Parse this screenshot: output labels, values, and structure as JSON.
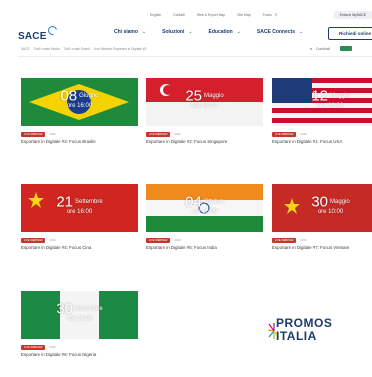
{
  "utility": {
    "links": [
      "English",
      "Contatti",
      "Web & Export Map",
      "Site Map",
      "Focus"
    ],
    "access": "Entra in MySACE"
  },
  "header": {
    "brand": "SACE",
    "nav": [
      {
        "label": "Chi siamo"
      },
      {
        "label": "Soluzioni"
      },
      {
        "label": "Education"
      },
      {
        "label": "SACE Connects"
      }
    ],
    "cta": "Richiedi online"
  },
  "breadcrumb": [
    "SACE",
    "Tutti i nostri Media",
    "Tutti i nostri Eventi",
    "Live Webinar Esportare in Digitale #3"
  ],
  "share": {
    "label": "Condividi"
  },
  "cards": [
    {
      "day": "08",
      "month": "Giugno",
      "hour": "ore 16:00",
      "tag": "LIVE WEBINAR",
      "year": "2020",
      "title": "Esportare in Digitale #3: Focus Brasile",
      "flag": "brazil"
    },
    {
      "day": "25",
      "month": "Maggio",
      "hour": "ore 16:00",
      "tag": "LIVE WEBINAR",
      "year": "2020",
      "title": "Esportare in Digitale #2: Focus Singapore",
      "flag": "singapore"
    },
    {
      "day": "12",
      "month": "Maggio",
      "hour": "ore 16:00",
      "tag": "LIVE WEBINAR",
      "year": "2020",
      "title": "Esportare in Digitale #1: Focus USA",
      "flag": "usa"
    },
    {
      "day": "21",
      "month": "Settembre",
      "hour": "ore 16:00",
      "tag": "LIVE WEBINAR",
      "year": "2020",
      "title": "Esportare in Digitale #4: Focus Cina",
      "flag": "china"
    },
    {
      "day": "04",
      "month": "Ottobre",
      "hour": "ore 16:00",
      "tag": "LIVE WEBINAR",
      "year": "2020",
      "title": "Esportare in Digitale #5: Focus India",
      "flag": "india"
    },
    {
      "day": "30",
      "month": "Maggio",
      "hour": "ore 10:00",
      "tag": "LIVE WEBINAR",
      "year": "2020",
      "title": "Esportare in Digitale #7: Focus Vietnam",
      "flag": "vietnam"
    },
    {
      "day": "30",
      "month": "Novembre",
      "hour": "ore 16:00",
      "tag": "LIVE WEBINAR",
      "year": "2020",
      "title": "Esportare in Digitale #6: Focus Nigeria",
      "flag": "nigeria"
    }
  ],
  "partner": {
    "line1": "PROMOS",
    "line2": "ITALIA"
  },
  "colors": {
    "brand": "#1d3c6e",
    "tag": "#c0392b"
  }
}
